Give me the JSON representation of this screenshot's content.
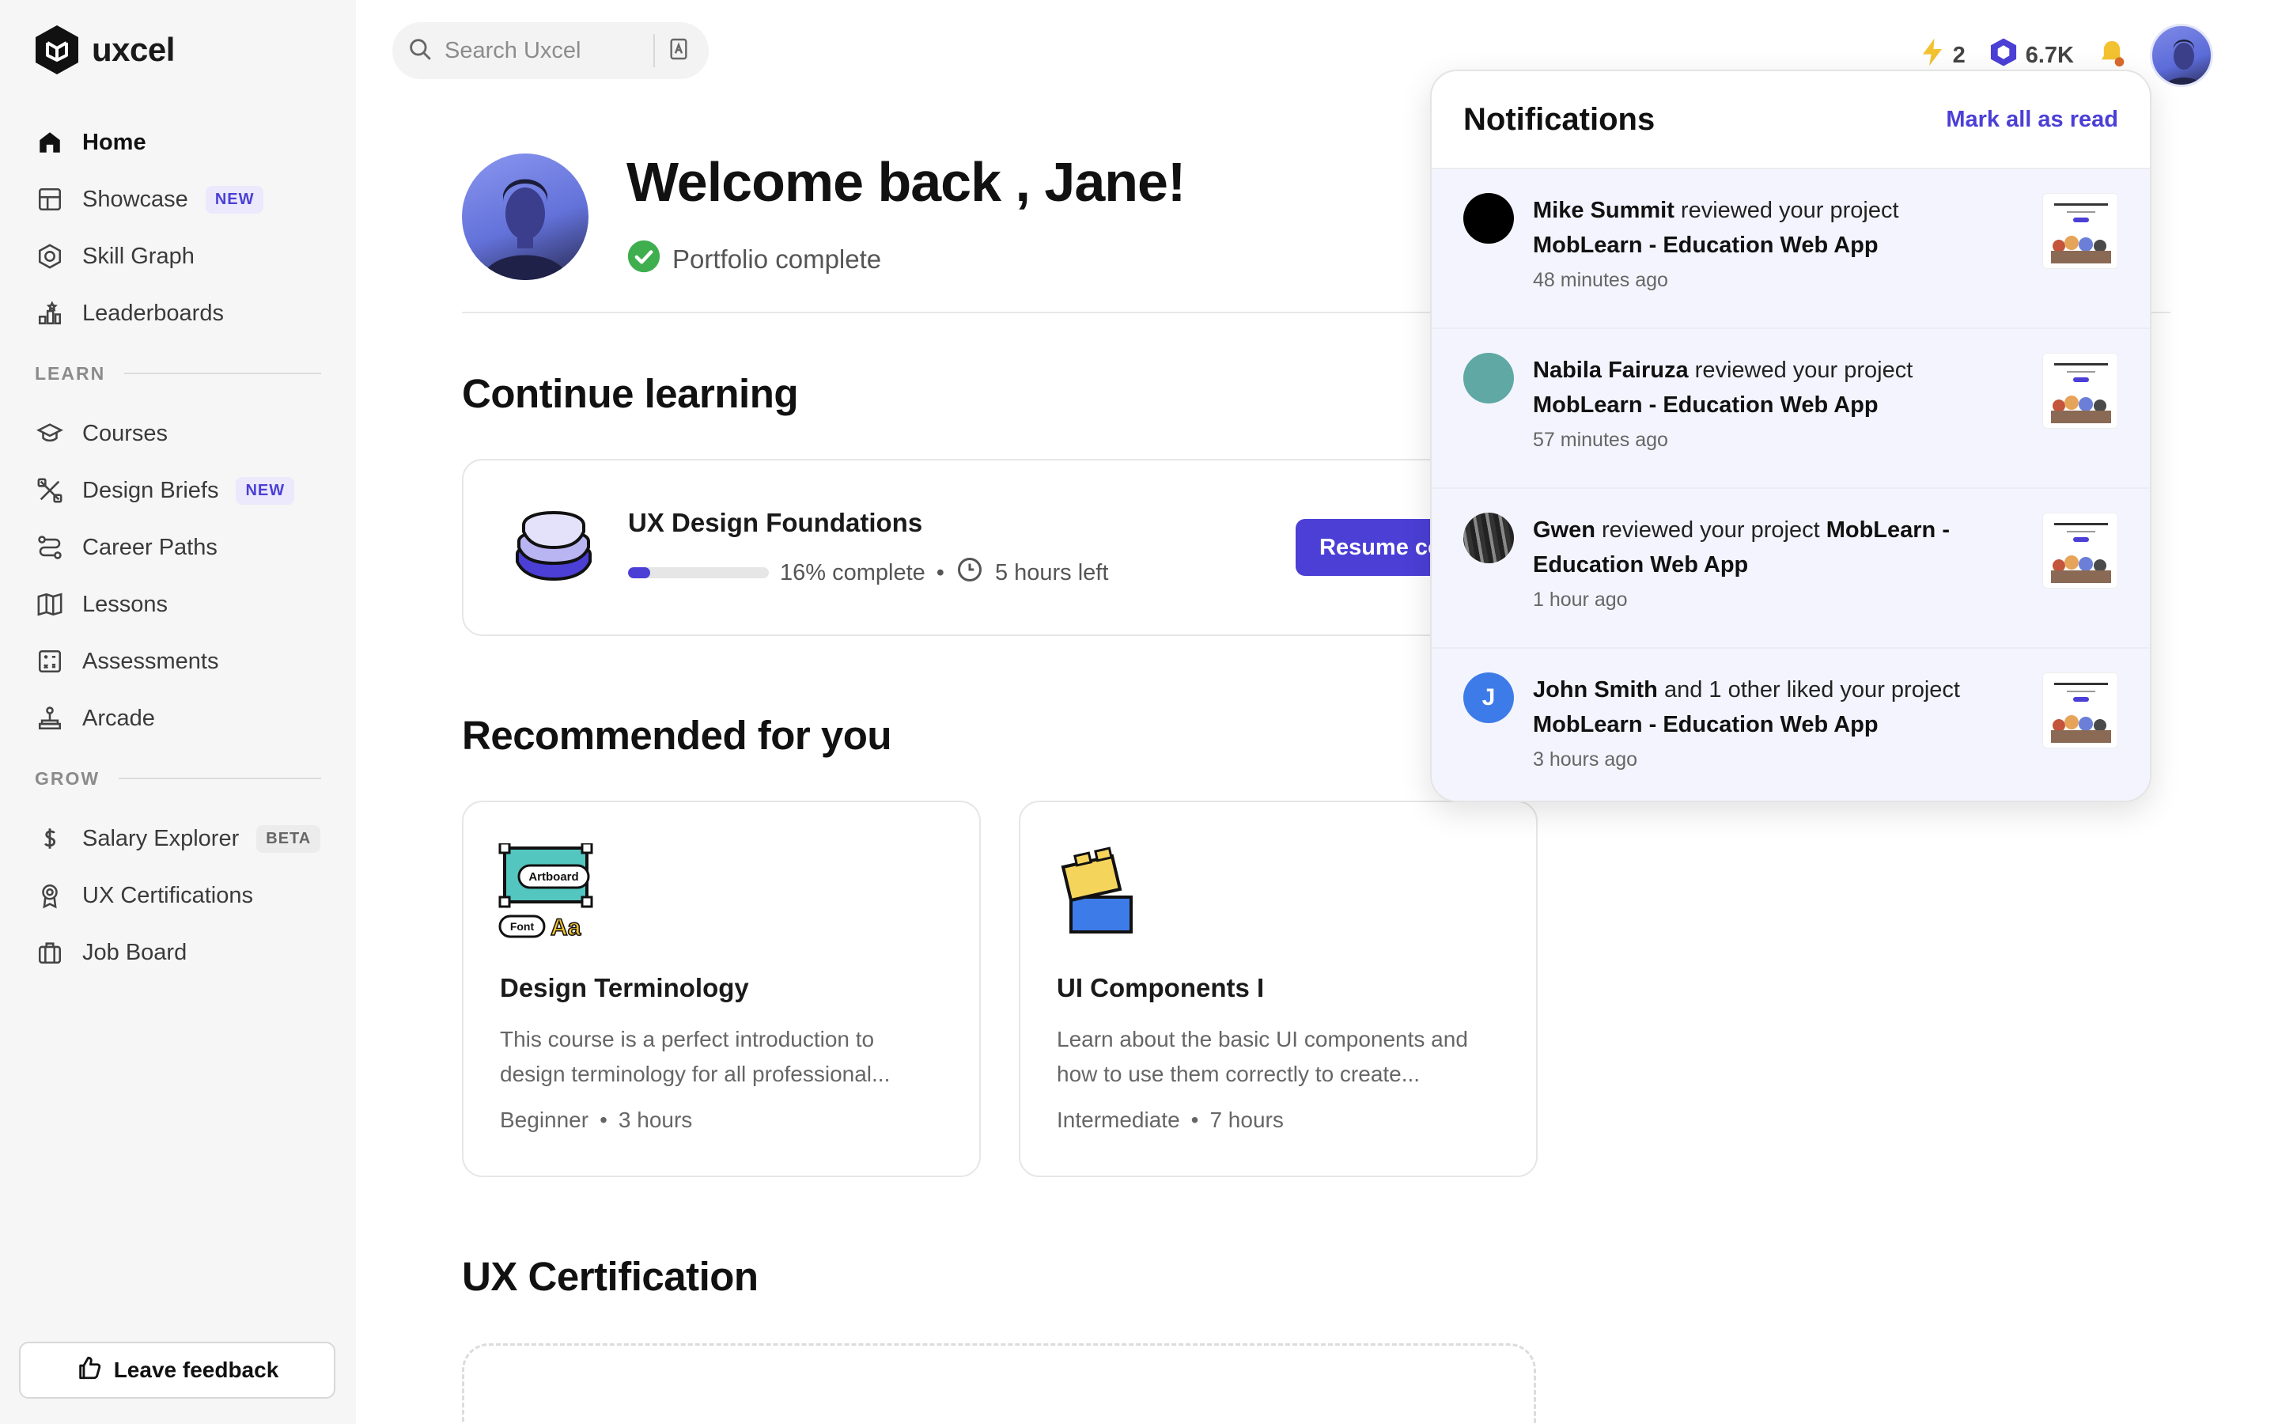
{
  "app": {
    "name": "uxcel"
  },
  "sidebar": {
    "items": [
      {
        "label": "Home",
        "icon": "home-icon",
        "active": true
      },
      {
        "label": "Showcase",
        "icon": "showcase-icon",
        "badge": "NEW"
      },
      {
        "label": "Skill Graph",
        "icon": "skill-graph-icon"
      },
      {
        "label": "Leaderboards",
        "icon": "leaderboards-icon"
      }
    ],
    "learn_heading": "LEARN",
    "learn_items": [
      {
        "label": "Courses",
        "icon": "graduation-cap-icon"
      },
      {
        "label": "Design Briefs",
        "icon": "design-briefs-icon",
        "badge": "NEW"
      },
      {
        "label": "Career Paths",
        "icon": "career-paths-icon"
      },
      {
        "label": "Lessons",
        "icon": "book-icon"
      },
      {
        "label": "Assessments",
        "icon": "assessments-icon"
      },
      {
        "label": "Arcade",
        "icon": "joystick-icon"
      }
    ],
    "grow_heading": "GROW",
    "grow_items": [
      {
        "label": "Salary Explorer",
        "icon": "dollar-icon",
        "badge": "BETA"
      },
      {
        "label": "UX Certifications",
        "icon": "certificate-icon"
      },
      {
        "label": "Job Board",
        "icon": "briefcase-icon"
      }
    ],
    "feedback_label": "Leave feedback"
  },
  "topbar": {
    "search_placeholder": "Search Uxcel",
    "streak": "2",
    "points": "6.7K"
  },
  "welcome": {
    "title": "Welcome back , Jane!",
    "portfolio_status": "Portfolio complete"
  },
  "continue": {
    "heading": "Continue learning",
    "course_title": "UX Design Foundations",
    "progress_percent": 16,
    "progress_text": "16% complete",
    "time_left": "5 hours left",
    "resume_label": "Resume co"
  },
  "recommended": {
    "heading": "Recommended for you",
    "cards": [
      {
        "title": "Design Terminology",
        "description": "This course is a perfect introduction to design terminology for all professional...",
        "level": "Beginner",
        "duration": "3 hours",
        "illus_artboard": "Artboard",
        "illus_font": "Font",
        "illus_aa": "Aa"
      },
      {
        "title": "UI Components I",
        "description": "Learn about the basic UI components and how to use them correctly to create...",
        "level": "Intermediate",
        "duration": "7 hours"
      }
    ]
  },
  "certification": {
    "heading": "UX Certification"
  },
  "notifications": {
    "title": "Notifications",
    "mark_all_label": "Mark all as read",
    "items": [
      {
        "actor": "Mike Summit",
        "action": " reviewed your project ",
        "project": "MobLearn - Education Web App",
        "time": "48 minutes ago",
        "avatar_color": "#000000"
      },
      {
        "actor": "Nabila Fairuza",
        "action": " reviewed your project ",
        "project": "MobLearn - Education Web App",
        "time": "57 minutes ago",
        "avatar_color": "#5fa8a4"
      },
      {
        "actor": "Gwen",
        "action": " reviewed your project ",
        "project": "MobLearn - Education Web App",
        "time": "1 hour ago",
        "avatar_color": "#333333"
      },
      {
        "actor": "John Smith",
        "action": " and 1 other liked your project ",
        "project": "MobLearn - Education Web App",
        "time": "3 hours ago",
        "avatar_color": "#3d7be8",
        "avatar_initial": "J"
      }
    ]
  },
  "colors": {
    "accent": "#4b3fd6",
    "success": "#3fae4f",
    "streak": "#f2c230"
  }
}
